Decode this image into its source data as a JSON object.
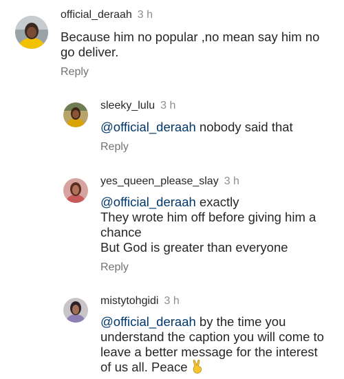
{
  "comments": [
    {
      "username": "official_deraah",
      "time": "3 h",
      "lines": [
        "Because him no popular ,no mean say him no",
        "go deliver."
      ],
      "reply_label": "Reply"
    },
    {
      "username": "sleeky_lulu",
      "time": "3 h",
      "mention": "@official_deraah",
      "line1_rest": " nobody said that",
      "reply_label": "Reply"
    },
    {
      "username": "yes_queen_please_slay",
      "time": "3 h",
      "mention": "@official_deraah",
      "line1_rest": " exactly",
      "lines": [
        "They wrote him off before giving him a",
        "chance",
        "But God is greater than everyone"
      ],
      "reply_label": "Reply"
    },
    {
      "username": "mistytohgidi",
      "time": "3 h",
      "mention": "@official_deraah",
      "line1_rest": " by the time you",
      "lines": [
        "understand the caption you will come to",
        "leave a better message for the interest",
        "of us all. Peace"
      ],
      "emoji_icon": "victory-hand-icon"
    }
  ],
  "colors": {
    "text": "#262626",
    "mention": "#00376b",
    "secondary": "#8e8e8e",
    "background": "#ffffff"
  }
}
